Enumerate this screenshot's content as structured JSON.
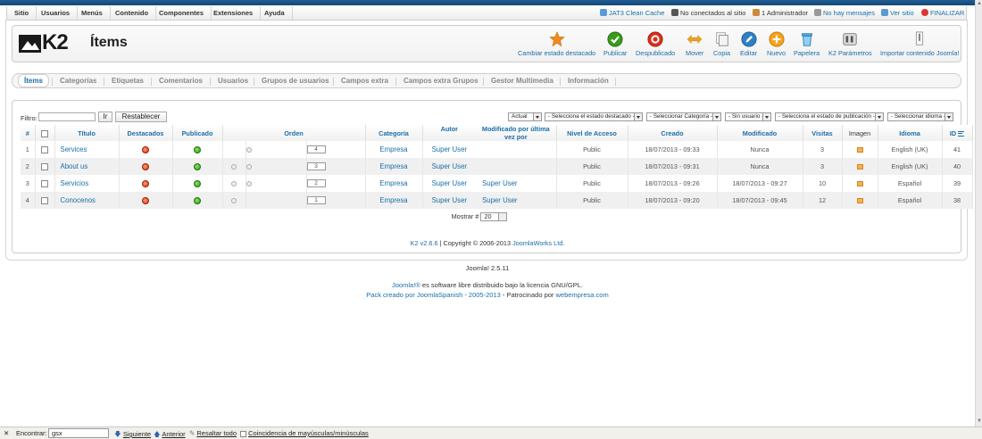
{
  "menu": [
    "Sitio",
    "Usuarios",
    "Menús",
    "Contenido",
    "Componentes",
    "Extensiones",
    "Ayuda"
  ],
  "status": {
    "cache": "JAT3 Clean Cache",
    "visitors": "No conectados al sitio",
    "admins": "1 Administrador",
    "messages": "No hay mensajes",
    "view_site": "Ver sitio",
    "logout": "FINALIZAR"
  },
  "header": {
    "logo": "K2",
    "title": "Ítems"
  },
  "toolbar": {
    "featured": "Cambiar estado destacado",
    "publish": "Publicar",
    "unpublish": "Despublicado",
    "move": "Mover",
    "copy": "Copia",
    "edit": "Editar",
    "new": "Nuevo",
    "trash": "Papelera",
    "params": "K2 Parámetros",
    "import": "Importar contenido Joomla!"
  },
  "tabs": [
    "Ítems",
    "Categorías",
    "Etiquetas",
    "Comentarios",
    "Usuarios",
    "Grupos de usuarios",
    "Campos extra",
    "Campos extra Grupos",
    "Gestor Multimedia",
    "Información"
  ],
  "filter": {
    "label": "Filtro:",
    "value": "",
    "go": "Ir",
    "reset": "Restablecer",
    "selects": {
      "state": "Actual",
      "featured": "- Selecciona el estado destacado -",
      "category": "- Seleccionar Categoría -",
      "user": "- Sin usuario -",
      "publish_state": "- Selecciona el estado de publicación -",
      "language": "- Seleccionar idioma -"
    }
  },
  "columns": {
    "num": "#",
    "title": "Título",
    "featured": "Destacados",
    "published": "Publicado",
    "order": "Orden",
    "category": "Categoría",
    "author": "Autor",
    "modified_by": "Modificado por última vez por",
    "access": "Nivel de Acceso",
    "created": "Creado",
    "modified": "Modificado",
    "hits": "Visitas",
    "image": "Imagen",
    "language": "Idioma",
    "id": "ID"
  },
  "rows": [
    {
      "num": "1",
      "title": "Services",
      "order": "4",
      "category": "Empresa",
      "author": "Super User",
      "modified_by": "",
      "access": "Public",
      "created": "18/07/2013 - 09:33",
      "modified": "Nunca",
      "hits": "3",
      "language": "English (UK)",
      "id": "41"
    },
    {
      "num": "2",
      "title": "About us",
      "order": "3",
      "category": "Empresa",
      "author": "Super User",
      "modified_by": "",
      "access": "Public",
      "created": "18/07/2013 - 09:31",
      "modified": "Nunca",
      "hits": "3",
      "language": "English (UK)",
      "id": "40"
    },
    {
      "num": "3",
      "title": "Servicios",
      "order": "2",
      "category": "Empresa",
      "author": "Super User",
      "modified_by": "Super User",
      "access": "Public",
      "created": "18/07/2013 - 09:26",
      "modified": "18/07/2013 - 09:27",
      "hits": "10",
      "language": "Español",
      "id": "39"
    },
    {
      "num": "4",
      "title": "Conocenos",
      "order": "1",
      "category": "Empresa",
      "author": "Super User",
      "modified_by": "Super User",
      "access": "Public",
      "created": "18/07/2013 - 09:20",
      "modified": "18/07/2013 - 09:45",
      "hits": "12",
      "language": "Español",
      "id": "38"
    }
  ],
  "pager": {
    "label": "Mostrar #",
    "value": "20"
  },
  "credit": {
    "version": "K2 v2.6.6",
    "text": " | Copyright © 2006-2013 ",
    "company": "JoomlaWorks Ltd."
  },
  "footer": {
    "version": "Joomla! 2.5.11",
    "license_link": "Joomla!®",
    "license_text": " es software libre distribuido bajo la licencia GNU/GPL.",
    "pack_link": "Pack creado por JoomlaSpanish - 2005-2013",
    "pack_text": " - Patrocinado por ",
    "sponsor": "webempresa.com"
  },
  "findbar": {
    "label": "Encontrar:",
    "value": "gsx",
    "next": "Siguiente",
    "prev": "Anterior",
    "highlight": "Resaltar todo",
    "match_case": "Coincidencia de mayúsculas/minúsculas"
  },
  "colors": {
    "link": "#1a6ea8",
    "topbar": "#1f5e99",
    "featured": "#d1310e",
    "published": "#2c9a14"
  }
}
